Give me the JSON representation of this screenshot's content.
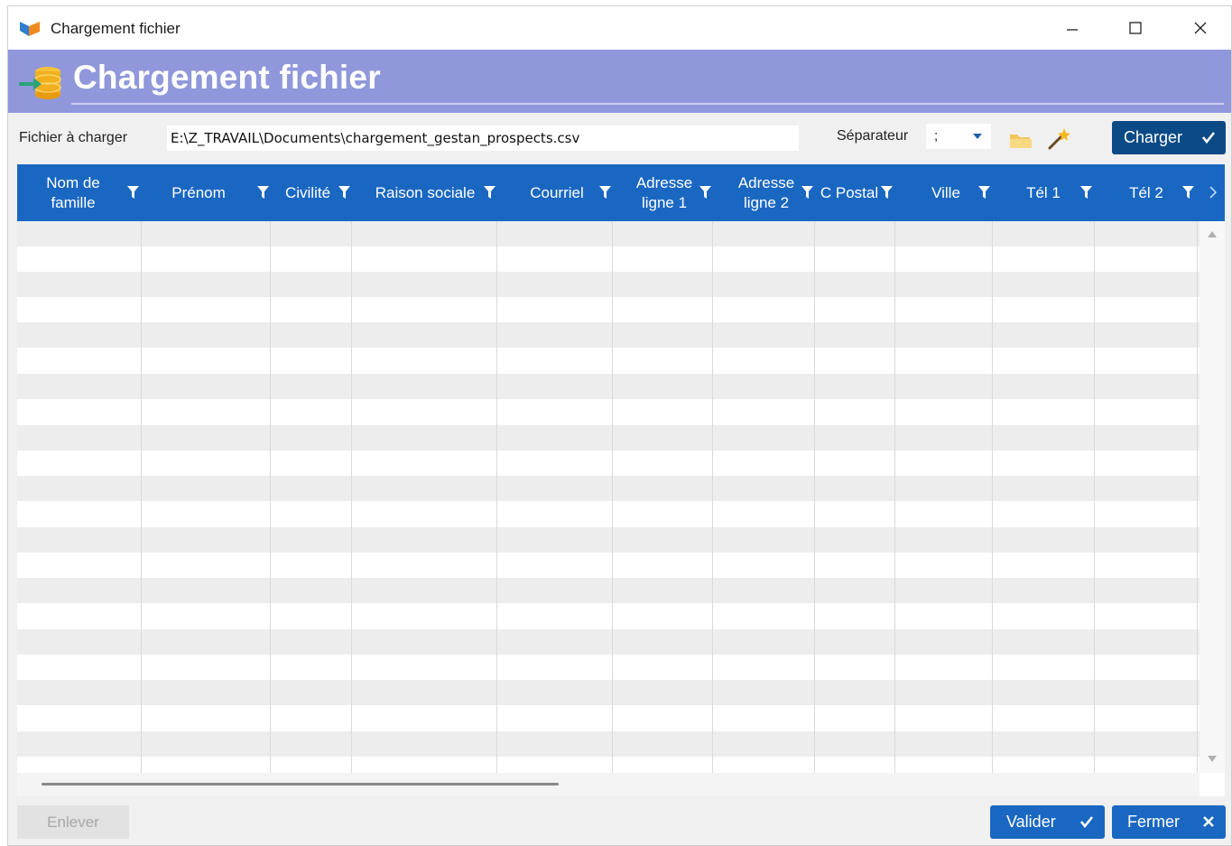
{
  "window": {
    "title": "Chargement fichier",
    "minimize_label": "—",
    "maximize_label": "☐",
    "close_label": "✕"
  },
  "banner": {
    "title": "Chargement fichier"
  },
  "file": {
    "label": "Fichier à charger",
    "value": "E:\\Z_TRAVAIL\\Documents\\chargement_gestan_prospects.csv"
  },
  "separator": {
    "label": "Séparateur",
    "value": ";"
  },
  "toolbar": {
    "charger_label": "Charger"
  },
  "grid": {
    "columns": [
      {
        "label": "Nom de famille"
      },
      {
        "label": "Prénom"
      },
      {
        "label": "Civilité"
      },
      {
        "label": "Raison sociale"
      },
      {
        "label": "Courriel"
      },
      {
        "label": "Adresse ligne 1"
      },
      {
        "label": "Adresse ligne 2"
      },
      {
        "label": "C Postal"
      },
      {
        "label": "Ville"
      },
      {
        "label": "Tél 1"
      },
      {
        "label": "Tél 2"
      }
    ],
    "rows": []
  },
  "footer": {
    "enlever_label": "Enlever",
    "valider_label": "Valider",
    "fermer_label": "Fermer"
  },
  "colors": {
    "banner": "#9098db",
    "header": "#1a67c2",
    "dark_button": "#0c4a86"
  }
}
